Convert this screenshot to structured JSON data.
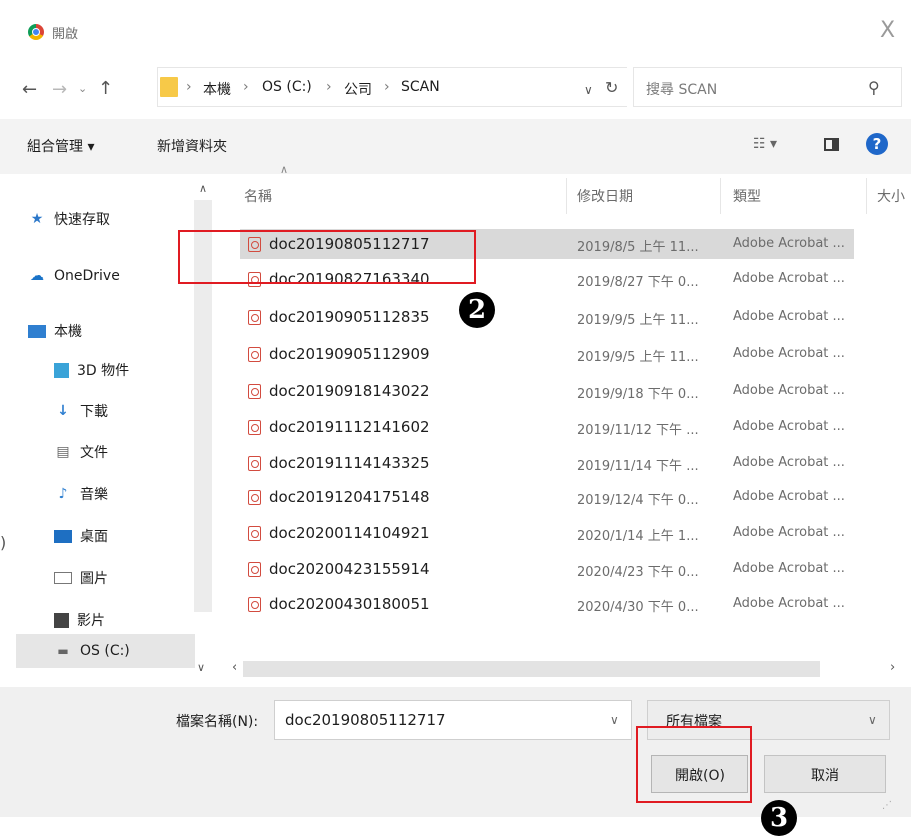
{
  "window": {
    "title": "開啟",
    "close": "X"
  },
  "address": {
    "crumbs": [
      "本機",
      "OS (C:)",
      "公司",
      "SCAN"
    ],
    "separator": "›",
    "search_placeholder": "搜尋 SCAN"
  },
  "toolbar": {
    "organize": "組合管理 ▾",
    "new_folder": "新增資料夾",
    "view": "▾",
    "help": "?"
  },
  "nav": {
    "items": [
      {
        "label": "快速存取",
        "icon": "star-icon"
      },
      {
        "label": "OneDrive",
        "icon": "cloud-icon"
      },
      {
        "label": "本機",
        "icon": "computer-icon"
      },
      {
        "label": "3D 物件",
        "icon": "cube-icon"
      },
      {
        "label": "下載",
        "icon": "download-icon"
      },
      {
        "label": "文件",
        "icon": "document-icon"
      },
      {
        "label": "音樂",
        "icon": "music-icon"
      },
      {
        "label": "桌面",
        "icon": "desktop-icon"
      },
      {
        "label": "圖片",
        "icon": "pictures-icon"
      },
      {
        "label": "影片",
        "icon": "video-icon"
      },
      {
        "label": "OS (C:)",
        "icon": "drive-icon"
      }
    ]
  },
  "columns": {
    "name": "名稱",
    "date": "修改日期",
    "type": "類型",
    "size": "大小"
  },
  "files": [
    {
      "name": "doc20190805112717",
      "date": "2019/8/5 上午 11...",
      "type": "Adobe Acrobat ..."
    },
    {
      "name": "doc20190827163340",
      "date": "2019/8/27 下午 0...",
      "type": "Adobe Acrobat ..."
    },
    {
      "name": "doc20190905112835",
      "date": "2019/9/5 上午 11...",
      "type": "Adobe Acrobat ..."
    },
    {
      "name": "doc20190905112909",
      "date": "2019/9/5 上午 11...",
      "type": "Adobe Acrobat ..."
    },
    {
      "name": "doc20190918143022",
      "date": "2019/9/18 下午 0...",
      "type": "Adobe Acrobat ..."
    },
    {
      "name": "doc20191112141602",
      "date": "2019/11/12 下午 ...",
      "type": "Adobe Acrobat ..."
    },
    {
      "name": "doc20191114143325",
      "date": "2019/11/14 下午 ...",
      "type": "Adobe Acrobat ..."
    },
    {
      "name": "doc20191204175148",
      "date": "2019/12/4 下午 0...",
      "type": "Adobe Acrobat ..."
    },
    {
      "name": "doc20200114104921",
      "date": "2020/1/14 上午 1...",
      "type": "Adobe Acrobat ..."
    },
    {
      "name": "doc20200423155914",
      "date": "2020/4/23 下午 0...",
      "type": "Adobe Acrobat ..."
    },
    {
      "name": "doc20200430180051",
      "date": "2020/4/30 下午 0...",
      "type": "Adobe Acrobat ..."
    }
  ],
  "footer": {
    "filename_label": "檔案名稱(N):",
    "filename_value": "doc20190805112717",
    "filter_value": "所有檔案",
    "open_label": "開啟(O)",
    "cancel_label": "取消"
  },
  "annotations": {
    "marker_2": "❷",
    "marker_3": "❸",
    "accent": "#e01b22"
  },
  "misc": {
    "left_paren": ")"
  }
}
